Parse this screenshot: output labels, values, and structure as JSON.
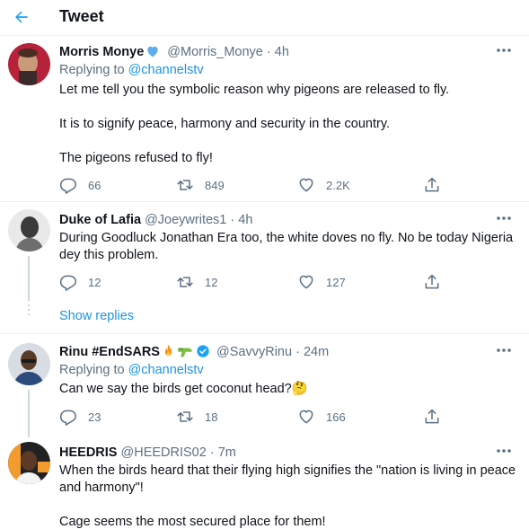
{
  "header": {
    "title": "Tweet"
  },
  "tweets": [
    {
      "name": "Morris Monye",
      "handle": "@Morris_Monye",
      "time": "4h",
      "reply_label": "Replying to",
      "reply_to": "@channelstv",
      "paragraphs": [
        "Let me tell you the symbolic reason why pigeons are released to fly.",
        "It is to signify peace, harmony and security in the country.",
        "The pigeons refused to fly!"
      ],
      "replies": "66",
      "retweets": "849",
      "likes": "2.2K"
    },
    {
      "name": "Duke of Lafia",
      "handle": "@Joeywrites1",
      "time": "4h",
      "paragraphs": [
        "During Goodluck Jonathan Era too, the white doves no fly. No be today Nigeria dey this problem."
      ],
      "replies": "12",
      "retweets": "12",
      "likes": "127"
    },
    {
      "name": "Rinu #EndSARS",
      "handle": "@SavvyRinu",
      "time": "24m",
      "reply_label": "Replying to",
      "reply_to": "@channelstv",
      "paragraphs": [
        "Can we say the birds get coconut head?"
      ],
      "replies": "23",
      "retweets": "18",
      "likes": "166"
    },
    {
      "name": "HEEDRIS",
      "handle": "@HEEDRIS02",
      "time": "7m",
      "paragraphs": [
        "When the birds heard that their flying high signifies the \"nation is living in peace and harmony\"!",
        "Cage seems the most secured place for them!"
      ]
    }
  ],
  "show_replies": "Show replies",
  "separator": "·",
  "emoji": {
    "thinking": "🤔"
  },
  "colors": {
    "accent": "#1b95e0",
    "verified": "#1da1f2",
    "secondary_text": "#5b7083",
    "blue_heart": "#5dadec"
  }
}
